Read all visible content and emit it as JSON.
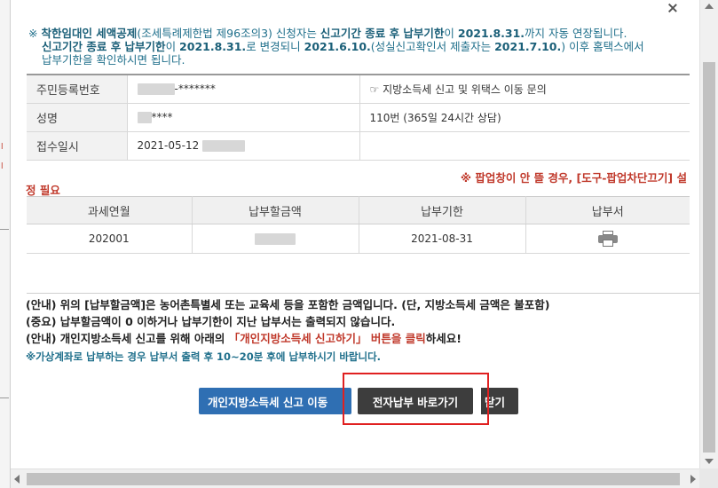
{
  "notice": {
    "line1_prefix": "※ ",
    "line1_bold1": "착한임대인 세액공제",
    "line1_mid": "(조세특례제한법 제96조의3) 신청자는 ",
    "line1_bold2": "신고기간 종료 후 납부기한",
    "line1_mid2": "이 ",
    "line1_bold3": "2021.8.31.",
    "line1_end": "까지 자동 연장됩니다.",
    "line2_bold1": "신고기간 종료 후 납부기한",
    "line2_mid": "이 ",
    "line2_bold2": "2021.8.31.",
    "line2_mid2": "로 변경되니 ",
    "line2_bold3": "2021.6.10.",
    "line2_mid3": "(성실신고확인서 제출자는 ",
    "line2_bold4": "2021.7.10.",
    "line2_end": ") 이후 홈택스에서",
    "line3": "납부기한을 확인하시면 됩니다."
  },
  "info": {
    "rrn_label": "주민등록번호",
    "rrn_value": "-*******",
    "name_label": "성명",
    "name_value": "****",
    "date_label": "접수일시",
    "date_value": "2021-05-12",
    "right1": "☞ 지방소득세 신고 및 위택스 이동 문의",
    "right2": "110번 (365일 24시간 상담)"
  },
  "popup_warning": "※ 팝업창이 안 뜰 경우, [도구-팝업차단끄기] 설",
  "popup_warning2": "정 필요",
  "pay_table": {
    "headers": [
      "과세연월",
      "납부할금액",
      "납부기한",
      "납부서"
    ],
    "row": {
      "period": "202001",
      "due_date": "2021-08-31"
    }
  },
  "guide": {
    "line1": "(안내) 위의 [납부할금액]은 농어촌특별세 또는 교육세 등을 포함한 금액입니다. (단, 지방소득세 금액은 불포함)",
    "line2": "(중요) 납부할금액이 0 이하거나 납부기한이 지난 납부서는 출력되지 않습니다.",
    "line3_a": "(안내) 개인지방소득세 신고를 위해  아래의 ",
    "line3_red": "「개인지방소득세 신고하기」 버튼을 클릭",
    "line3_b": "하세요!",
    "line4": "※가상계좌로 납부하는 경우 납부서 출력 후 10~20분 후에 납부하시기 바랍니다."
  },
  "buttons": {
    "local_tax": "개인지방소득세 신고 이동",
    "e_payment": "전자납부 바로가기",
    "close": "닫기"
  },
  "colors": {
    "accent_blue": "#2f6fb3",
    "dark_button": "#3d3d3d",
    "notice_teal": "#1f6f8b",
    "warning_red": "#c0392b",
    "highlight_red": "#e02020"
  },
  "icons": {
    "printer": "printer-icon"
  }
}
